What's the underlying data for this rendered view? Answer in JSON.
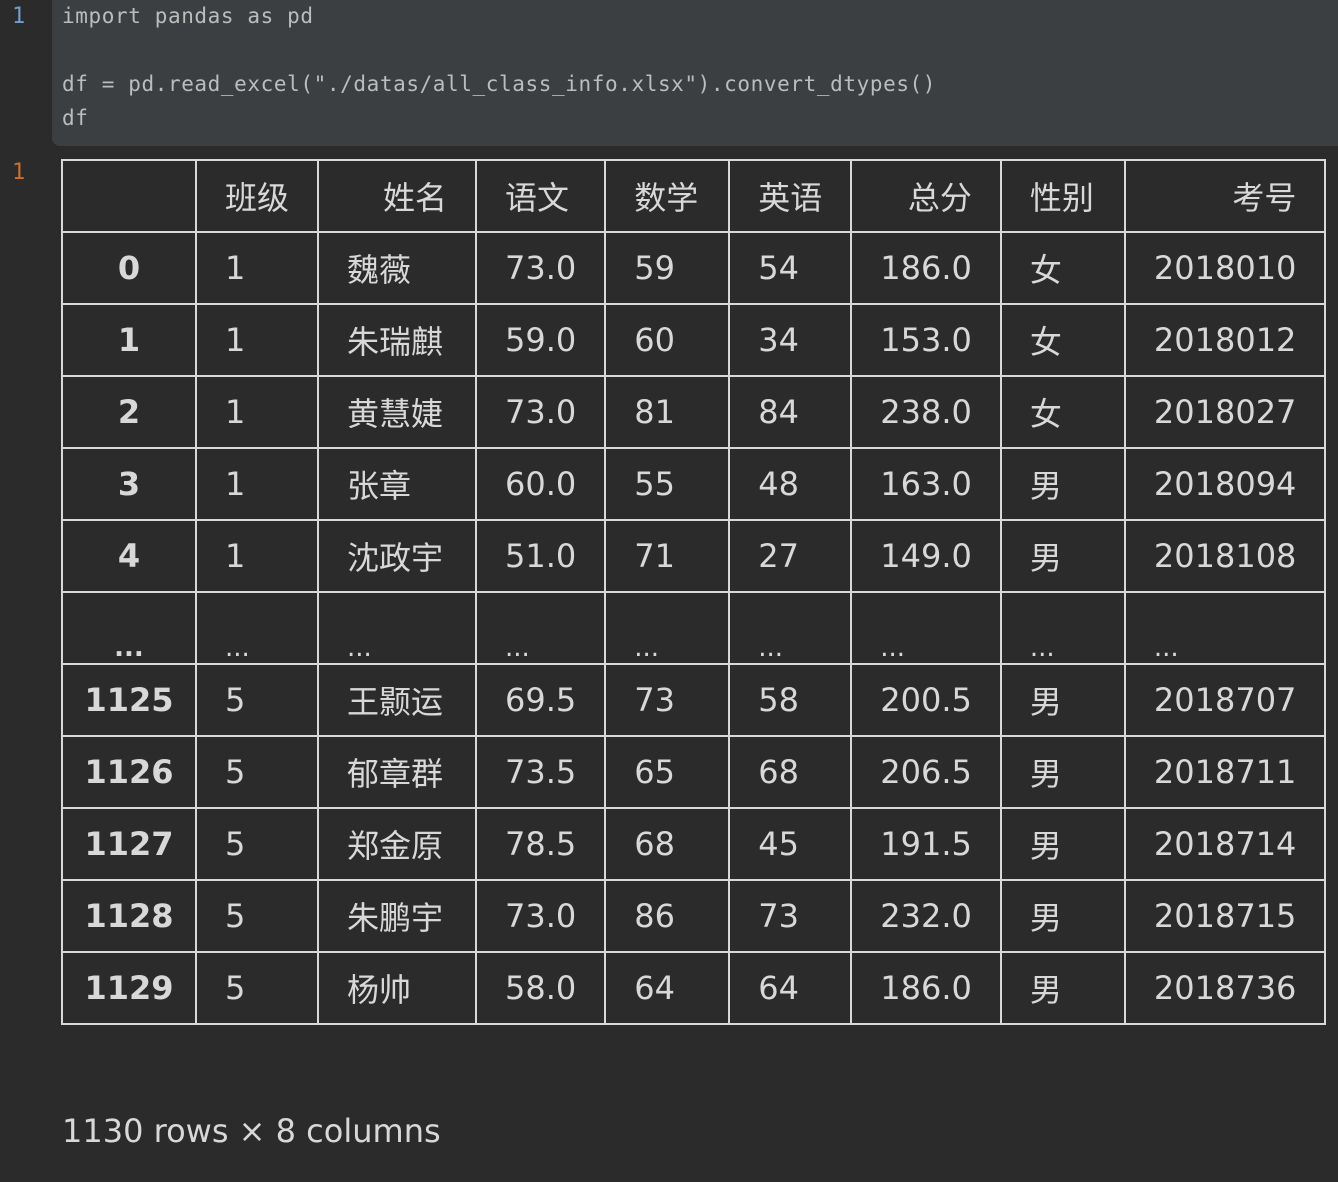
{
  "input_prompt": "1",
  "output_prompt": "1",
  "code": {
    "line1": "import pandas as pd",
    "line3": "df = pd.read_excel(\"./datas/all_class_info.xlsx\").convert_dtypes()",
    "line4": "df"
  },
  "table": {
    "columns": [
      "",
      "班级",
      "姓名",
      "语文",
      "数学",
      "英语",
      "总分",
      "性别",
      "考号"
    ],
    "rows": [
      [
        "0",
        "1",
        "魏薇",
        "73.0",
        "59",
        "54",
        "186.0",
        "女",
        "2018010"
      ],
      [
        "1",
        "1",
        "朱瑞麒",
        "59.0",
        "60",
        "34",
        "153.0",
        "女",
        "2018012"
      ],
      [
        "2",
        "1",
        "黄慧婕",
        "73.0",
        "81",
        "84",
        "238.0",
        "女",
        "2018027"
      ],
      [
        "3",
        "1",
        "张章",
        "60.0",
        "55",
        "48",
        "163.0",
        "男",
        "2018094"
      ],
      [
        "4",
        "1",
        "沈政宇",
        "51.0",
        "71",
        "27",
        "149.0",
        "男",
        "2018108"
      ],
      [
        "...",
        "...",
        "...",
        "...",
        "...",
        "...",
        "...",
        "...",
        "..."
      ],
      [
        "1125",
        "5",
        "王颢运",
        "69.5",
        "73",
        "58",
        "200.5",
        "男",
        "2018707"
      ],
      [
        "1126",
        "5",
        "郁章群",
        "73.5",
        "65",
        "68",
        "206.5",
        "男",
        "2018711"
      ],
      [
        "1127",
        "5",
        "郑金原",
        "78.5",
        "68",
        "45",
        "191.5",
        "男",
        "2018714"
      ],
      [
        "1128",
        "5",
        "朱鹏宇",
        "73.0",
        "86",
        "73",
        "232.0",
        "男",
        "2018715"
      ],
      [
        "1129",
        "5",
        "杨帅",
        "58.0",
        "64",
        "64",
        "186.0",
        "男",
        "2018736"
      ]
    ]
  },
  "shape_caption": "1130 rows × 8 columns"
}
